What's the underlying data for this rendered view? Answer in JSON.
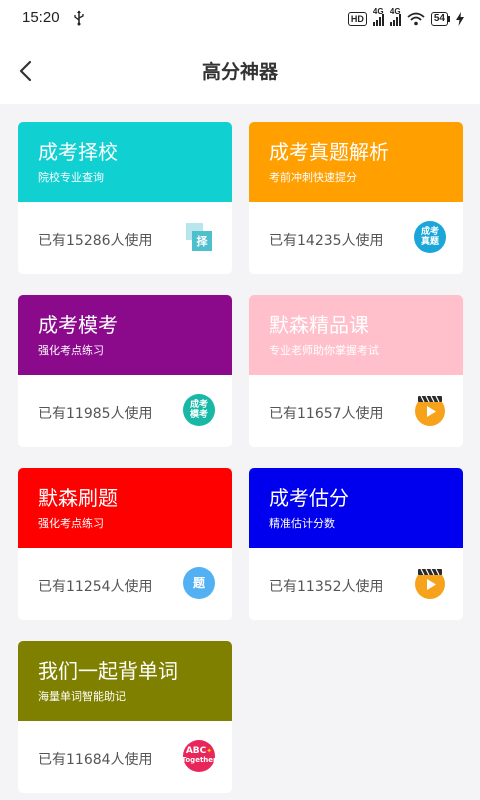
{
  "status_bar": {
    "time": "15:20",
    "hd_label": "HD",
    "network_1": "4G",
    "network_2": "4G",
    "battery": "54"
  },
  "header": {
    "title": "高分神器",
    "back_icon": "chevron-left-icon"
  },
  "cards": [
    {
      "title": "成考择校",
      "subtitle": "院校专业查询",
      "usage": "已有15286人使用",
      "color": "#11d0d2",
      "icon": "school-select-icon",
      "icon_text": "择"
    },
    {
      "title": "成考真题解析",
      "subtitle": "考前冲刺快速提分",
      "usage": "已有14235人使用",
      "color": "#ff9f00",
      "icon": "exam-questions-icon",
      "icon_text_1": "成考",
      "icon_text_2": "真题"
    },
    {
      "title": "成考模考",
      "subtitle": "强化考点练习",
      "usage": "已有11985人使用",
      "color": "#8b0a8c",
      "icon": "mock-exam-icon",
      "icon_text_1": "成考",
      "icon_text_2": "模考"
    },
    {
      "title": "默森精品课",
      "subtitle": "专业老师助你掌握考试",
      "usage": "已有11657人使用",
      "color": "#ffc0cb",
      "icon": "video-play-icon"
    },
    {
      "title": "默森刷题",
      "subtitle": "强化考点练习",
      "usage": "已有11254人使用",
      "color": "#ff0000",
      "icon": "question-bank-icon",
      "icon_text": "题"
    },
    {
      "title": "成考估分",
      "subtitle": "精准估计分数",
      "usage": "已有11352人使用",
      "color": "#0000ee",
      "icon": "video-play-icon"
    },
    {
      "title": "我们一起背单词",
      "subtitle": "海量单词智能助记",
      "usage": "已有11684人使用",
      "color": "#808000",
      "icon": "abc-together-icon",
      "icon_text_1": "ABC",
      "icon_text_2": "Together"
    }
  ]
}
